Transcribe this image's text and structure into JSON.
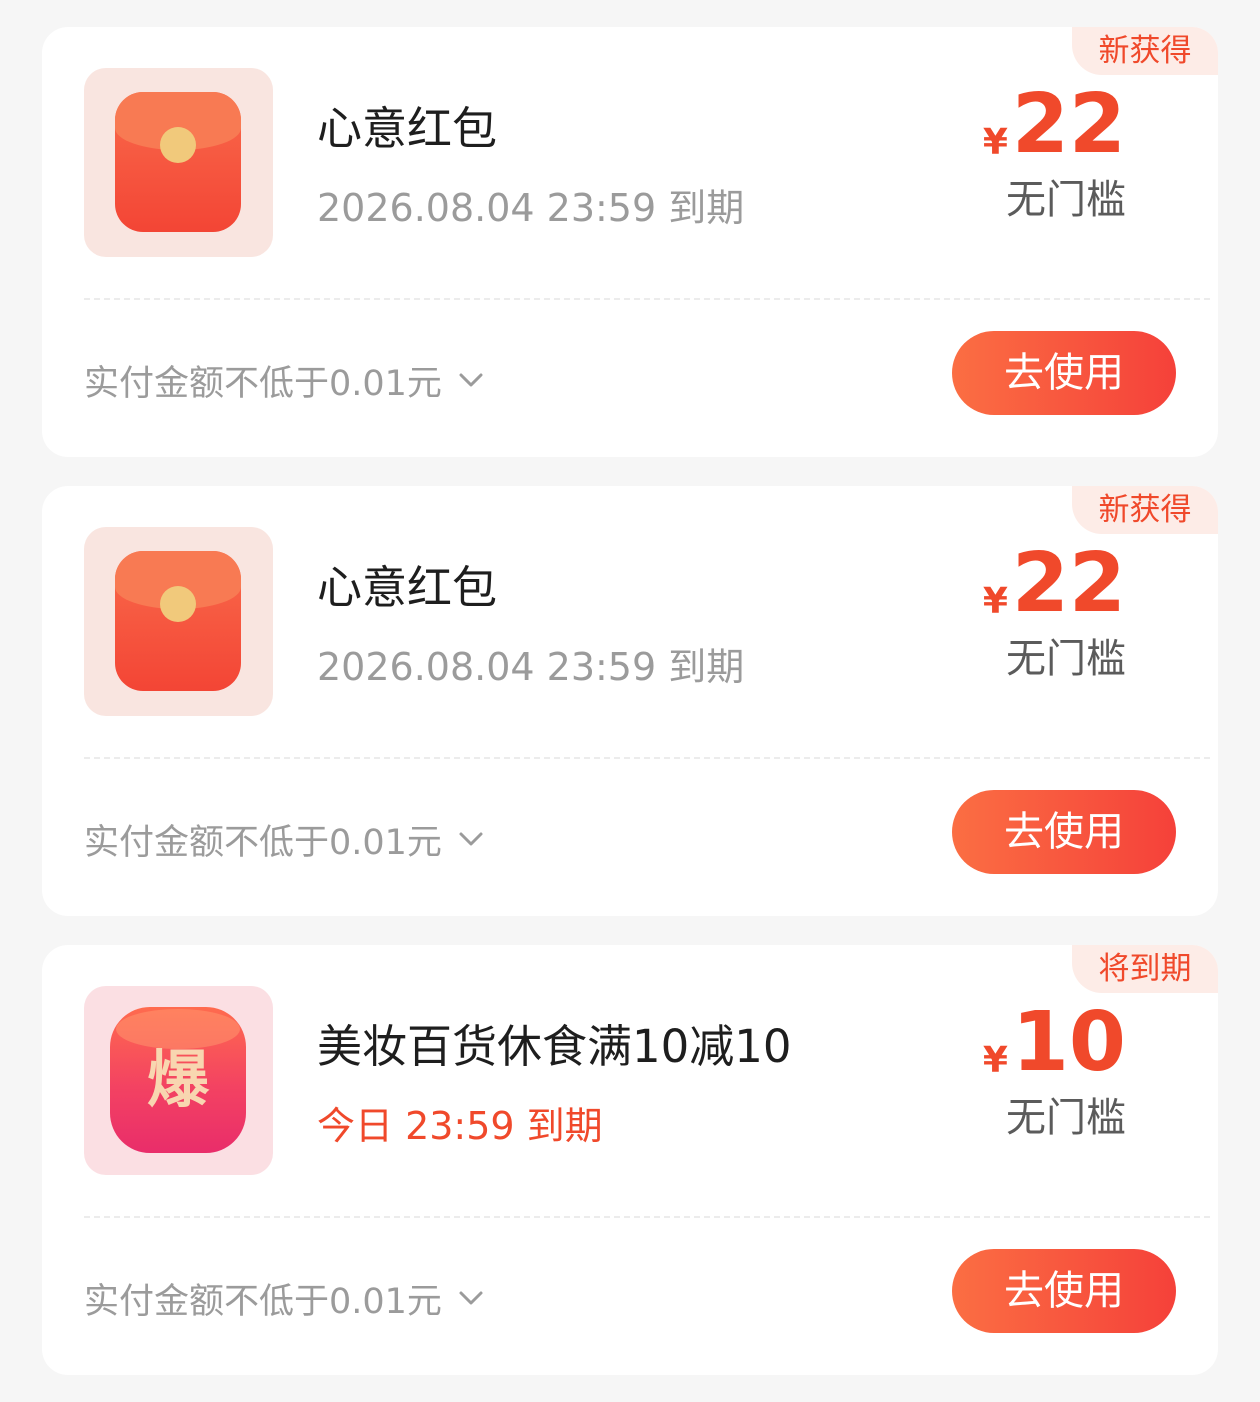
{
  "coupons": [
    {
      "tag": "新获得",
      "icon": "red-packet-icon",
      "title": "心意红包",
      "expiry": "2026.08.04 23:59 到期",
      "currency": "¥",
      "amount": "22",
      "threshold": "无门槛",
      "condition": "实付金额不低于0.01元",
      "button_label": "去使用"
    },
    {
      "tag": "新获得",
      "icon": "red-packet-icon",
      "title": "心意红包",
      "expiry": "2026.08.04 23:59 到期",
      "currency": "¥",
      "amount": "22",
      "threshold": "无门槛",
      "condition": "实付金额不低于0.01元",
      "button_label": "去使用"
    },
    {
      "tag": "将到期",
      "icon": "hot-deal-icon",
      "icon_text": "爆",
      "title": "美妆百货休食满10减10",
      "expiry": "今日 23:59 到期",
      "currency": "¥",
      "amount": "10",
      "threshold": "无门槛",
      "condition": "实付金额不低于0.01元",
      "button_label": "去使用"
    }
  ],
  "colors": {
    "accent": "#f0492b",
    "page_background": "#f6f6f6",
    "card_background": "#ffffff",
    "muted_text": "#9b9b9b"
  }
}
